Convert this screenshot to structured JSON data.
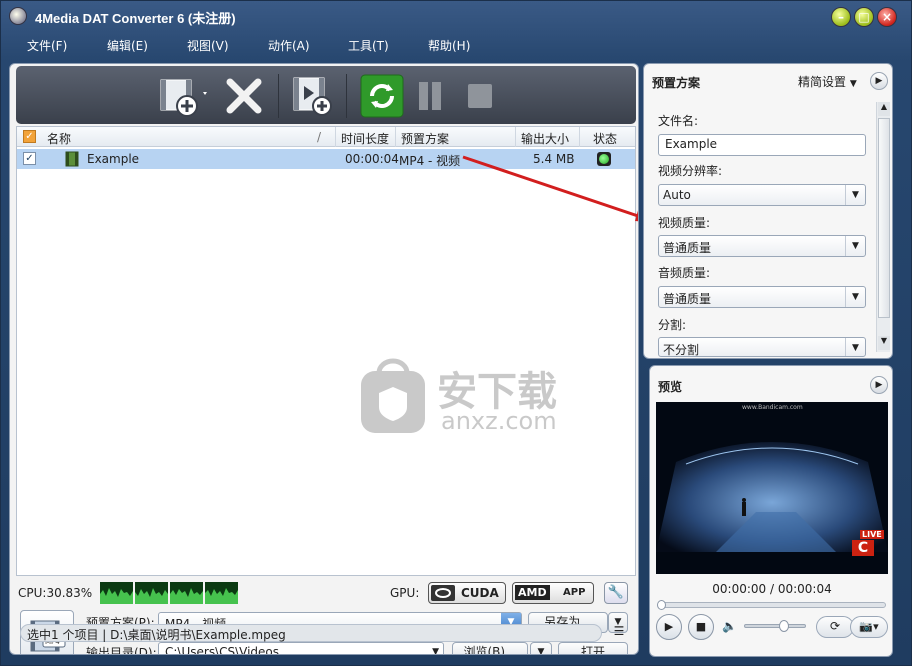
{
  "window": {
    "title": "4Media DAT Converter 6 (未注册)",
    "min": "–",
    "max": "□",
    "close": "×"
  },
  "menu": [
    "文件(F)",
    "编辑(E)",
    "视图(V)",
    "动作(A)",
    "工具(T)",
    "帮助(H)"
  ],
  "list": {
    "headers": {
      "name": "名称",
      "sep": "/",
      "duration": "时间长度",
      "profile": "预置方案",
      "size": "输出大小",
      "status": "状态"
    },
    "rows": [
      {
        "name": "Example",
        "duration": "00:00:04",
        "profile": "MP4 - 视频",
        "size": "5.4 MB",
        "checked": true
      }
    ]
  },
  "watermark": {
    "text": "安下载",
    "sub": "anxz.com"
  },
  "status": {
    "cpu": "CPU:30.83%",
    "gpu_label": "GPU:",
    "cuda": "CUDA",
    "amd": "AMD",
    "app": "APP"
  },
  "bottom": {
    "profile_label": "预置方案(P):",
    "profile_value": "MP4 - 视频",
    "save_as": "另存为...",
    "output_label": "输出目录(D):",
    "output_value": "C:\\Users\\CS\\Videos",
    "browse": "浏览(B)...",
    "open": "打开",
    "statusbar": "选中1 个项目 | D:\\桌面\\说明书\\Example.mpeg"
  },
  "profile_panel": {
    "title": "预置方案",
    "mode": "精简设置",
    "file_name_label": "文件名:",
    "file_name_value": "Example",
    "resolution_label": "视频分辨率:",
    "resolution_value": "Auto",
    "video_quality_label": "视频质量:",
    "video_quality_value": "普通质量",
    "audio_quality_label": "音频质量:",
    "audio_quality_value": "普通质量",
    "split_label": "分割:",
    "split_value": "不分割"
  },
  "preview": {
    "title": "预览",
    "time": "00:00:00 / 00:00:04",
    "video_watermark": "www.Bandicam.com",
    "live": "LIVE"
  },
  "colors": {
    "accent": "#2f9a2a",
    "selection": "#b7d3f2",
    "titlebar": "#2d4c76"
  }
}
